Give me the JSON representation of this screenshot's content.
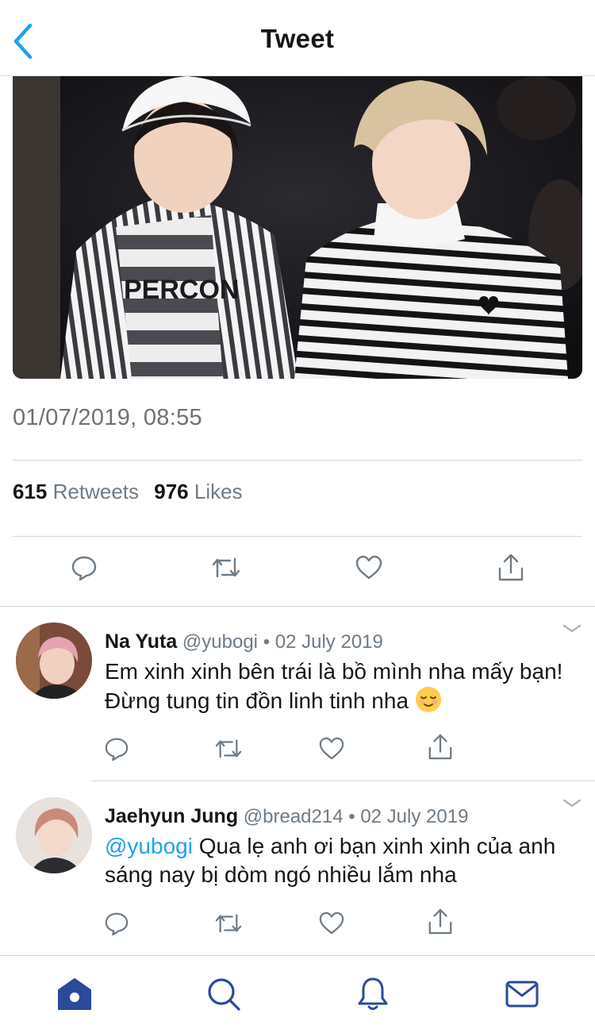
{
  "header": {
    "title": "Tweet",
    "back_icon": "chevron-left-icon"
  },
  "tweet": {
    "timestamp": "01/07/2019, 08:55",
    "retweets_count": "615",
    "retweets_label": "Retweets",
    "likes_count": "976",
    "likes_label": "Likes",
    "photo_text": "PERCON",
    "actions": [
      "reply-icon",
      "retweet-icon",
      "like-icon",
      "share-icon"
    ]
  },
  "replies": [
    {
      "name": "Na Yuta",
      "handle": "@yubogi",
      "dot": "•",
      "date": "02 July 2019",
      "text": "Em xinh xinh bên trái là bồ mình nha mấy bạn! Đừng tung tin đồn linh tinh nha",
      "emoji": "relieved-face-emoji"
    },
    {
      "name": "Jaehyun Jung",
      "handle": "@bread214",
      "dot": "•",
      "date": "02 July 2019",
      "mention": "@yubogi",
      "text": " Qua lẹ anh ơi bạn xinh xinh của anh sáng nay bị dòm ngó nhiều lắm nha"
    }
  ],
  "tabbar": [
    "home-icon",
    "search-icon",
    "notifications-icon",
    "messages-icon"
  ],
  "colors": {
    "accent": "#1da1f2",
    "tab_active": "#1da1f2",
    "text_secondary": "#6f7b86",
    "home_active": "#2b4a9c"
  }
}
